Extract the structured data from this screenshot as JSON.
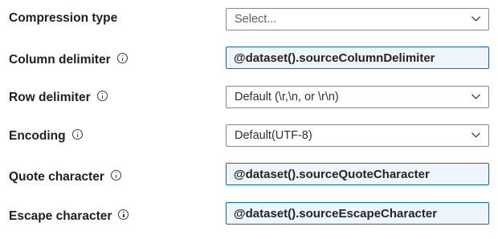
{
  "form": {
    "compression": {
      "label": "Compression type",
      "value": "Select..."
    },
    "column_delimiter": {
      "label": "Column delimiter",
      "value": "@dataset().sourceColumnDelimiter"
    },
    "row_delimiter": {
      "label": "Row delimiter",
      "value": "Default (\\r,\\n, or \\r\\n)"
    },
    "encoding": {
      "label": "Encoding",
      "value": "Default(UTF-8)"
    },
    "quote_character": {
      "label": "Quote character",
      "value": "@dataset().sourceQuoteCharacter"
    },
    "escape_character": {
      "label": "Escape character",
      "value": "@dataset().sourceEscapeCharacter"
    }
  },
  "icons": {
    "info": "info-icon",
    "dropdown": "chevron-down-icon"
  },
  "colors": {
    "dynamic_field_bg": "#eef5fc",
    "dynamic_field_border": "#0f6cbd",
    "field_border": "#8a8886"
  }
}
